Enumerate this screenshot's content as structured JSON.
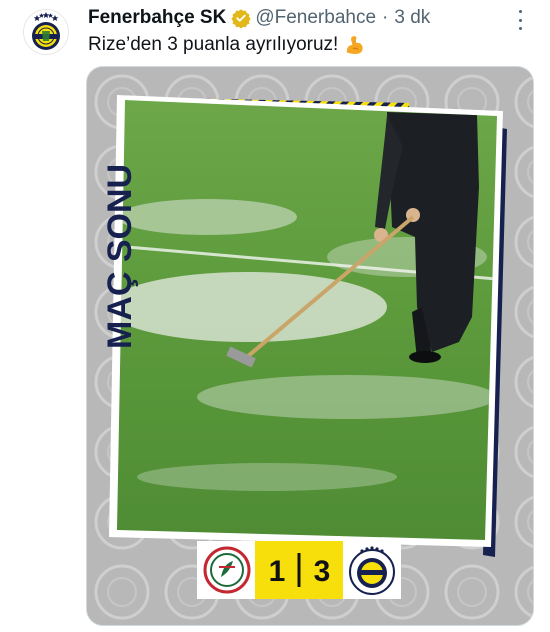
{
  "tweet": {
    "display_name": "Fenerbahçe SK",
    "handle": "@Fenerbahce",
    "separator": "·",
    "time": "3 dk",
    "text": "Rize’den 3 puanla ayrılıyoruz!",
    "emoji": "flexed-biceps"
  },
  "media": {
    "side_label": "MAÇ SONU",
    "home_score": "1",
    "away_score": "3",
    "home_team_logo": "rizespor-logo",
    "away_team_logo": "fenerbahce-logo"
  },
  "colors": {
    "accent_yellow": "#f6df0b",
    "navy": "#16214f",
    "verified_gold": "#e2b719",
    "pitch_green": "#5c9a3c"
  }
}
